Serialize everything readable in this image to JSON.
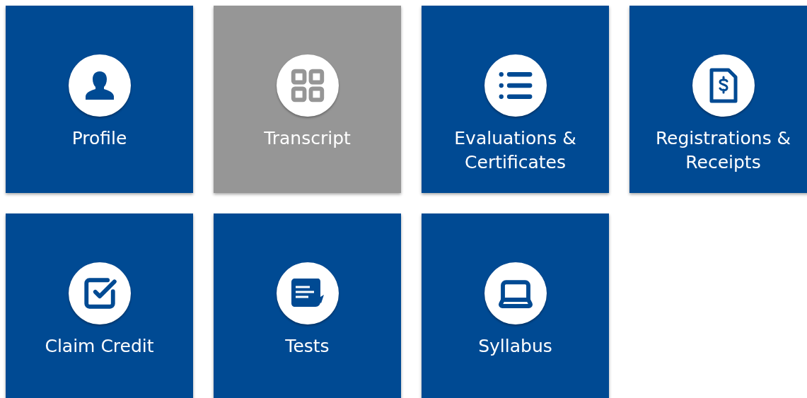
{
  "tiles": [
    {
      "label": "Profile",
      "selected": false
    },
    {
      "label": "Transcript",
      "selected": true
    },
    {
      "label": "Evaluations & Certificates",
      "selected": false
    },
    {
      "label": "Registrations & Receipts",
      "selected": false
    },
    {
      "label": "Claim Credit",
      "selected": false
    },
    {
      "label": "Tests",
      "selected": false
    },
    {
      "label": "Syllabus",
      "selected": false
    }
  ]
}
